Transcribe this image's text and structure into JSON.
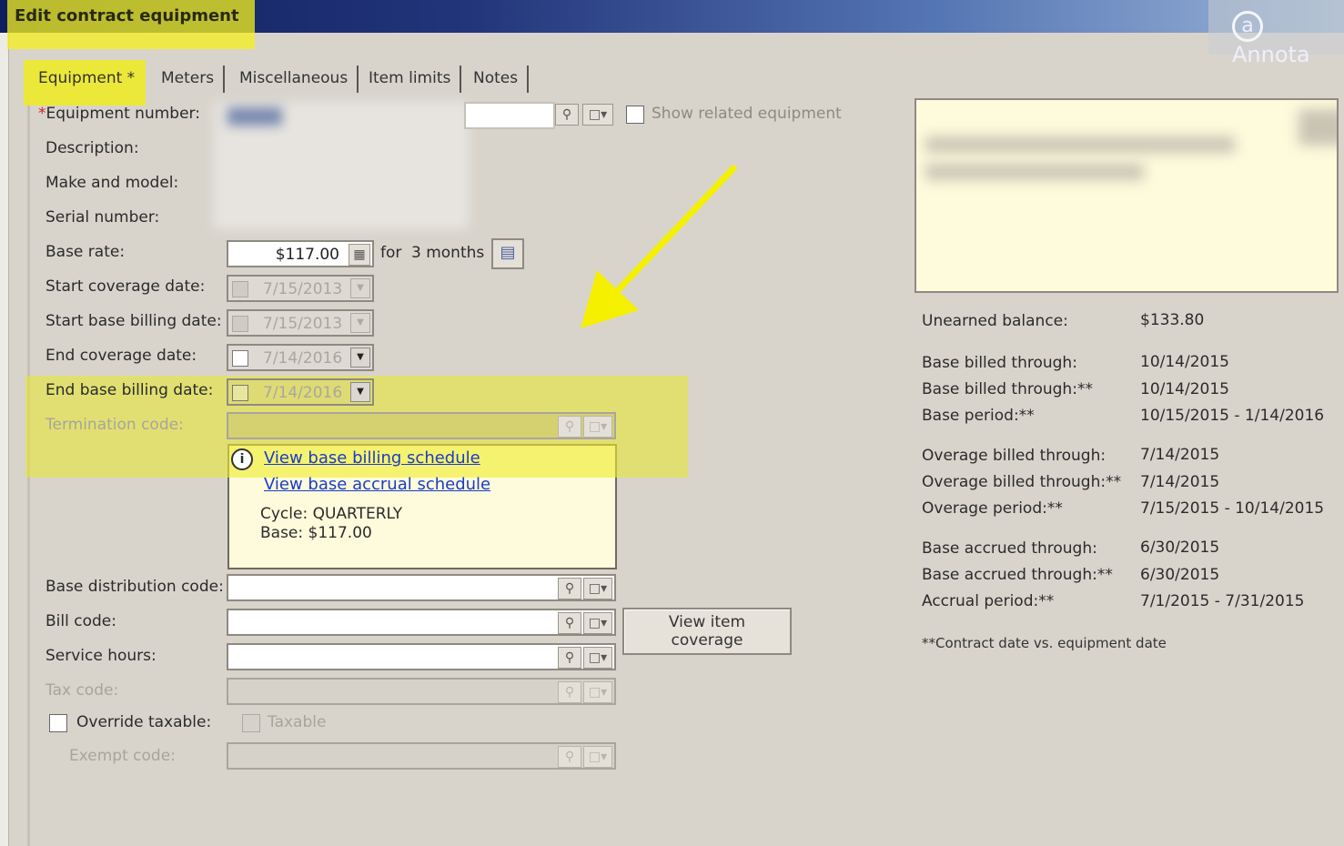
{
  "window": {
    "title": "Edit contract equipment",
    "annotate_label": "Annota"
  },
  "tabs": [
    {
      "label": "Equipment *",
      "active": true
    },
    {
      "label": "Meters"
    },
    {
      "label": "Miscellaneous"
    },
    {
      "label": "Item limits"
    },
    {
      "label": "Notes"
    }
  ],
  "form": {
    "equipment_number_label": "Equipment number:",
    "required_mark": "*",
    "show_related_label": "Show related equipment",
    "description_label": "Description:",
    "make_model_label": "Make and model:",
    "serial_label": "Serial number:",
    "base_rate_label": "Base rate:",
    "base_rate_value": "$117.00",
    "for_label": "for",
    "months_label": "3 months",
    "start_coverage_label": "Start coverage date:",
    "start_coverage_value": "7/15/2013",
    "start_base_billing_label": "Start base billing date:",
    "start_base_billing_value": "7/15/2013",
    "end_coverage_label": "End coverage date:",
    "end_coverage_value": "7/14/2016",
    "end_base_billing_label": "End base billing date:",
    "end_base_billing_value": "7/14/2016",
    "termination_label": "Termination code:",
    "base_distribution_label": "Base distribution code:",
    "bill_code_label": "Bill code:",
    "service_hours_label": "Service hours:",
    "tax_code_label": "Tax code:",
    "override_taxable_label": "Override taxable:",
    "taxable_label": "Taxable",
    "exempt_label": "Exempt code:",
    "view_item_coverage": "View item coverage"
  },
  "popup": {
    "link_billing": "View base billing schedule",
    "link_accrual": "View base accrual schedule",
    "cycle": "Cycle: QUARTERLY",
    "base": "Base: $117.00"
  },
  "summary": {
    "unearned_label": "Unearned balance:",
    "unearned_value": "$133.80",
    "base_billed_label": "Base billed through:",
    "base_billed_value": "10/14/2015",
    "base_billed2_label": "Base billed through:**",
    "base_billed2_value": "10/14/2015",
    "base_period_label": "Base period:**",
    "base_period_value": "10/15/2015 - 1/14/2016",
    "overage_billed_label": "Overage billed through:",
    "overage_billed_value": "7/14/2015",
    "overage_billed2_label": "Overage billed through:**",
    "overage_billed2_value": "7/14/2015",
    "overage_period_label": "Overage period:**",
    "overage_period_value": "7/15/2015 - 10/14/2015",
    "base_accrued_label": "Base accrued through:",
    "base_accrued_value": "6/30/2015",
    "base_accrued2_label": "Base accrued through:**",
    "base_accrued2_value": "6/30/2015",
    "accrual_period_label": "Accrual period:**",
    "accrual_period_value": "7/1/2015 - 7/31/2015",
    "footnote": "**Contract date vs. equipment date"
  },
  "icons": {
    "search": "search-icon",
    "dropdown": "dropdown-icon",
    "calendar": "calendar-icon",
    "info": "info-icon"
  },
  "colors": {
    "highlight": "#f0ec28",
    "link": "#1a3cc8",
    "arrow": "#f4f000"
  }
}
